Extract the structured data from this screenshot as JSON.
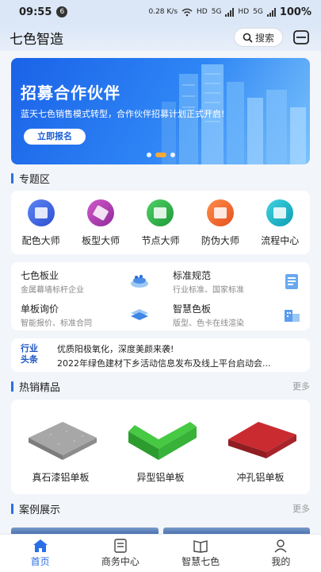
{
  "status_bar": {
    "time": "09:55",
    "notification_count": "6",
    "network_speed": "0.28 K/s",
    "hd1": "HD",
    "signal1": "5G",
    "hd2": "HD",
    "signal2": "5G",
    "battery": "100%"
  },
  "header": {
    "title": "七色智造",
    "search_label": "搜索",
    "scan_icon": "scan-icon"
  },
  "banner": {
    "title": "招募合作伙伴",
    "subtitle": "蓝天七色销售模式转型，合作伙伴招募计划正式开启!",
    "button": "立即报名",
    "dots": 3,
    "active_dot": 2,
    "colors": {
      "start": "#1a62e8",
      "end": "#7cc3fb"
    }
  },
  "special": {
    "title": "专题区",
    "items": [
      {
        "label": "配色大师",
        "icon": "palette-icon",
        "color": "#3a5fe0"
      },
      {
        "label": "板型大师",
        "icon": "panel-icon",
        "color": "#b23bb0"
      },
      {
        "label": "节点大师",
        "icon": "node-icon",
        "color": "#2fae4a"
      },
      {
        "label": "防伪大师",
        "icon": "anti-fake-icon",
        "color": "#ef6a2a"
      },
      {
        "label": "流程中心",
        "icon": "process-icon",
        "color": "#19b6c9"
      }
    ]
  },
  "info_grid": [
    {
      "title": "七色板业",
      "desc": "金属幕墙标杆企业",
      "icon": "company-icon"
    },
    {
      "title": "标准规范",
      "desc": "行业标准、国家标准",
      "icon": "standard-icon"
    },
    {
      "title": "单板询价",
      "desc": "智能报价、标准合同",
      "icon": "quote-icon"
    },
    {
      "title": "智慧色板",
      "desc": "版型、色卡在线渲染",
      "icon": "color-board-icon"
    }
  ],
  "news": {
    "logo_line1": "行业",
    "logo_line2": "头条",
    "items": [
      "优质阳极氧化，深度美颜来袭!",
      "2022年绿色建材下乡活动信息发布及线上平台启动会..."
    ]
  },
  "hot_products": {
    "title": "热销精品",
    "more": "更多",
    "items": [
      {
        "label": "真石漆铝单板",
        "color": "#9a9a9a"
      },
      {
        "label": "异型铝单板",
        "color": "#3fbf3a"
      },
      {
        "label": "冲孔铝单板",
        "color": "#c8262c"
      }
    ]
  },
  "cases": {
    "title": "案例展示",
    "more": "更多"
  },
  "tabbar": {
    "active": 0,
    "items": [
      {
        "label": "首页",
        "icon": "home-icon"
      },
      {
        "label": "商务中心",
        "icon": "business-icon"
      },
      {
        "label": "智慧七色",
        "icon": "book-icon"
      },
      {
        "label": "我的",
        "icon": "user-icon"
      }
    ]
  }
}
